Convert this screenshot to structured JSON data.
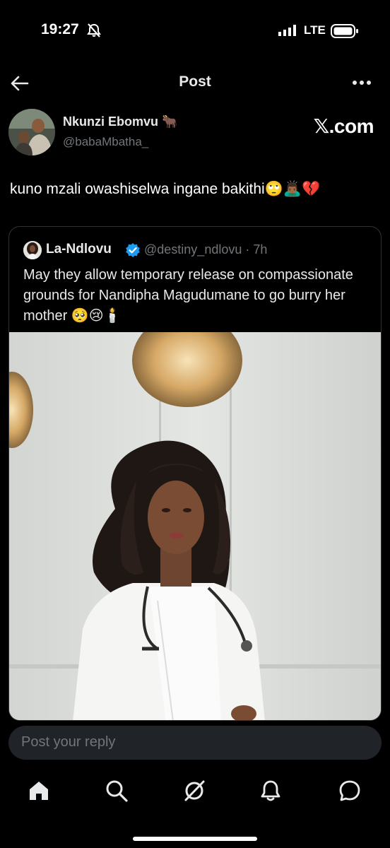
{
  "status_bar": {
    "time": "19:27",
    "network": "LTE",
    "icons": [
      "bell-off-icon",
      "signal-icon",
      "battery-icon"
    ]
  },
  "header": {
    "title": "Post",
    "icons": [
      "back-arrow-icon",
      "more-options-icon"
    ]
  },
  "tweet": {
    "author_name": "Nkunzi Ebomvu 🐂",
    "author_handle": "@babaMbatha_",
    "watermark": "𝕏.com",
    "text": "kuno mzali owashiselwa ingane bakithi🙄🙇🏾‍♂️💔"
  },
  "quoted_tweet": {
    "author_name": "La-Ndlovu",
    "author_handle": "@destiny_ndlovu · 7h",
    "text": "May they allow temporary release on compassionate grounds for Nandipha Magudumane to go burry her mother 🥺😢🕯️"
  },
  "reply": {
    "placeholder": "Post your reply"
  },
  "bottom_nav": {
    "items": [
      "home-icon",
      "search-icon",
      "grok-icon",
      "notifications-icon",
      "messages-icon"
    ]
  },
  "colors": {
    "background": "#000000",
    "text_primary": "#e7e9ea",
    "text_secondary": "#71767b",
    "verified": "#1d9bf0",
    "border": "#2f3336",
    "reply_bar": "#202327"
  }
}
